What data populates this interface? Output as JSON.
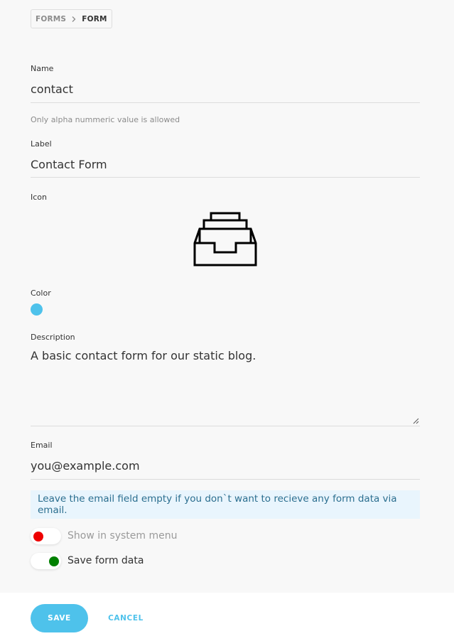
{
  "breadcrumb": {
    "parent": "FORMS",
    "current": "FORM"
  },
  "fields": {
    "name": {
      "label": "Name",
      "value": "contact",
      "hint": "Only alpha nummeric value is allowed"
    },
    "label": {
      "label": "Label",
      "value": "Contact Form"
    },
    "icon": {
      "label": "Icon",
      "icon_name": "inbox-tray-icon"
    },
    "color": {
      "label": "Color",
      "value": "#4ec2eb"
    },
    "description": {
      "label": "Description",
      "value": "A basic contact form for our static blog."
    },
    "email": {
      "label": "Email",
      "value": "you@example.com"
    }
  },
  "info": "Leave the email field empty if you don`t want to recieve any form data via email.",
  "toggles": [
    {
      "label": "Show in system menu",
      "on": false,
      "color": "#ee0000"
    },
    {
      "label": "Save form data",
      "on": true,
      "color": "#008000"
    }
  ],
  "actions": {
    "save": "SAVE",
    "cancel": "CANCEL"
  }
}
